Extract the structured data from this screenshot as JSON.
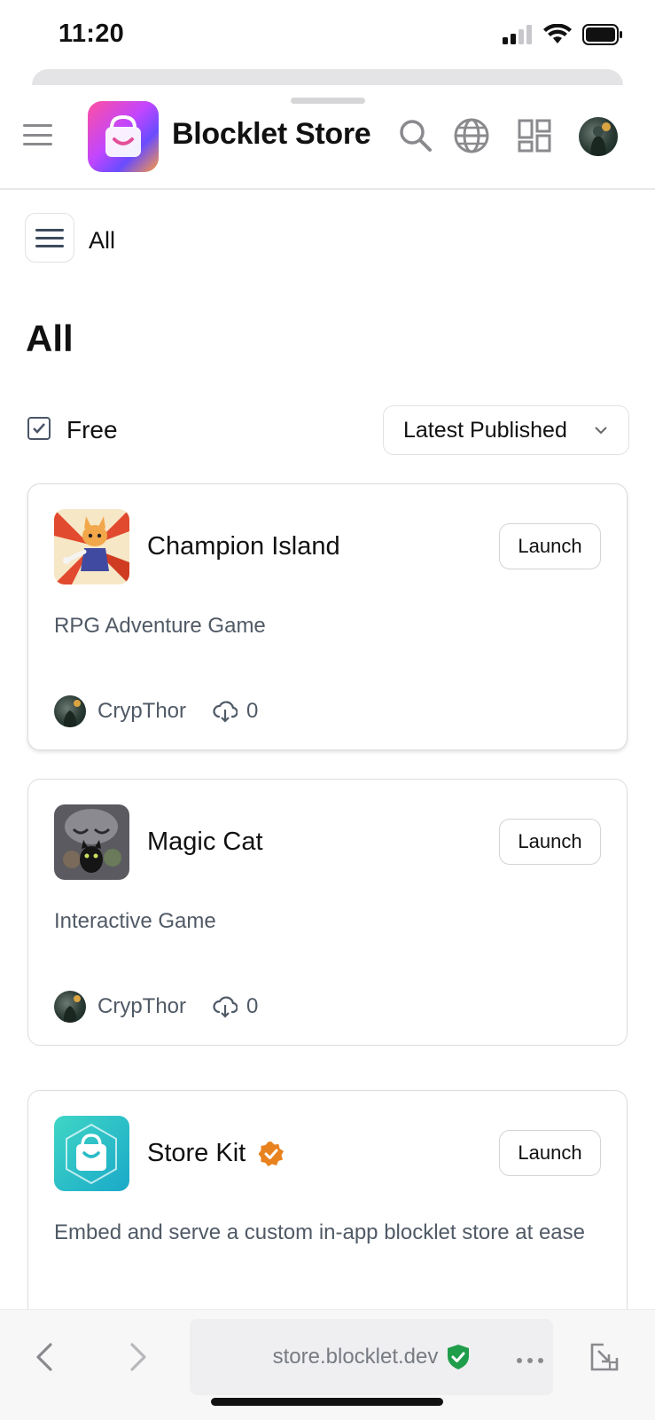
{
  "status_bar": {
    "time": "11:20",
    "icons": [
      "signal-icon",
      "wifi-icon",
      "battery-icon"
    ]
  },
  "header": {
    "title": "Blocklet Store",
    "icons": [
      "menu-icon",
      "store-logo-icon",
      "search-icon",
      "globe-icon",
      "apps-grid-icon",
      "user-avatar"
    ]
  },
  "category": {
    "label": "All"
  },
  "page": {
    "title": "All"
  },
  "filters": {
    "free_label": "Free",
    "free_checked": true,
    "sort_value": "Latest Published"
  },
  "cards": [
    {
      "name": "Champion Island",
      "description": "RPG Adventure Game",
      "author": "CrypThor",
      "downloads": "0",
      "launch_label": "Launch",
      "verified": false
    },
    {
      "name": "Magic Cat",
      "description": "Interactive Game",
      "author": "CrypThor",
      "downloads": "0",
      "launch_label": "Launch",
      "verified": false
    },
    {
      "name": "Store Kit",
      "description": "Embed and serve a custom in-app blocklet store at ease",
      "launch_label": "Launch",
      "verified": true
    }
  ],
  "browser": {
    "url": "store.blocklet.dev",
    "secure": true
  },
  "colors": {
    "accent_orange": "#e8821e",
    "secure_green": "#1f9d4a",
    "text_muted": "#505a66"
  }
}
